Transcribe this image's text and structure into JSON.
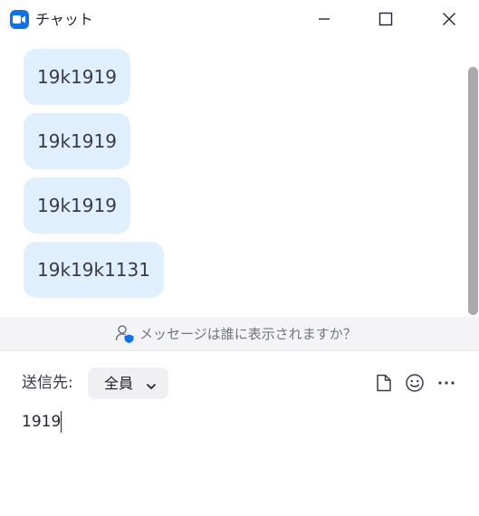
{
  "window": {
    "title": "チャット"
  },
  "messages": [
    {
      "text": "19k1919"
    },
    {
      "text": "19k1919"
    },
    {
      "text": "19k1919"
    },
    {
      "text": "19k19k1131"
    }
  ],
  "visibility_notice": "メッセージは誰に表示されますか？",
  "compose": {
    "to_label": "送信先:",
    "recipient": "全員",
    "input_value": "1919"
  },
  "icons": {
    "app": "zoom-camera-icon",
    "visibility": "person-shield-icon",
    "file": "file-icon",
    "emoji": "emoji-icon",
    "more": "more-horizontal-icon"
  },
  "colors": {
    "accent": "#0e72ed",
    "bubble": "#dfeffd",
    "notice_bg": "#f4f4f6"
  }
}
